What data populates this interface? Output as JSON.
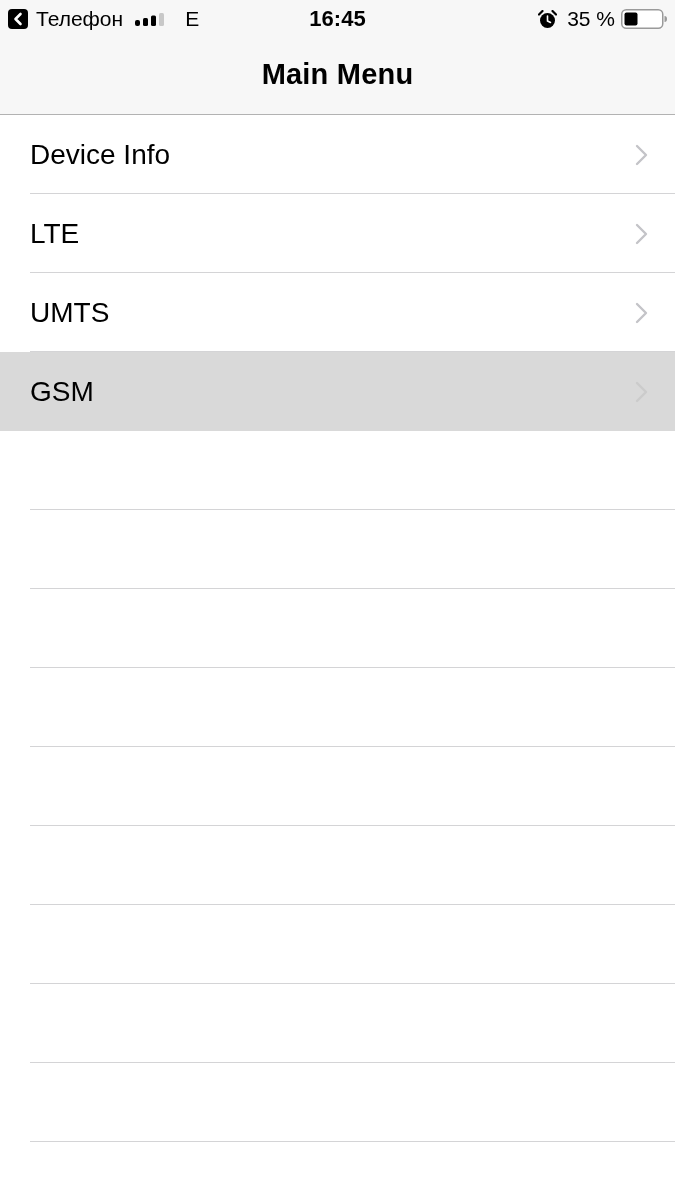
{
  "status_bar": {
    "back_label": "Телефон",
    "network": "E",
    "time": "16:45",
    "battery": "35 %"
  },
  "navigation_bar": {
    "title": "Main Menu"
  },
  "menu": {
    "items": [
      {
        "label": "Device Info",
        "selected": false
      },
      {
        "label": "LTE",
        "selected": false
      },
      {
        "label": "UMTS",
        "selected": false
      },
      {
        "label": "GSM",
        "selected": true
      }
    ]
  }
}
